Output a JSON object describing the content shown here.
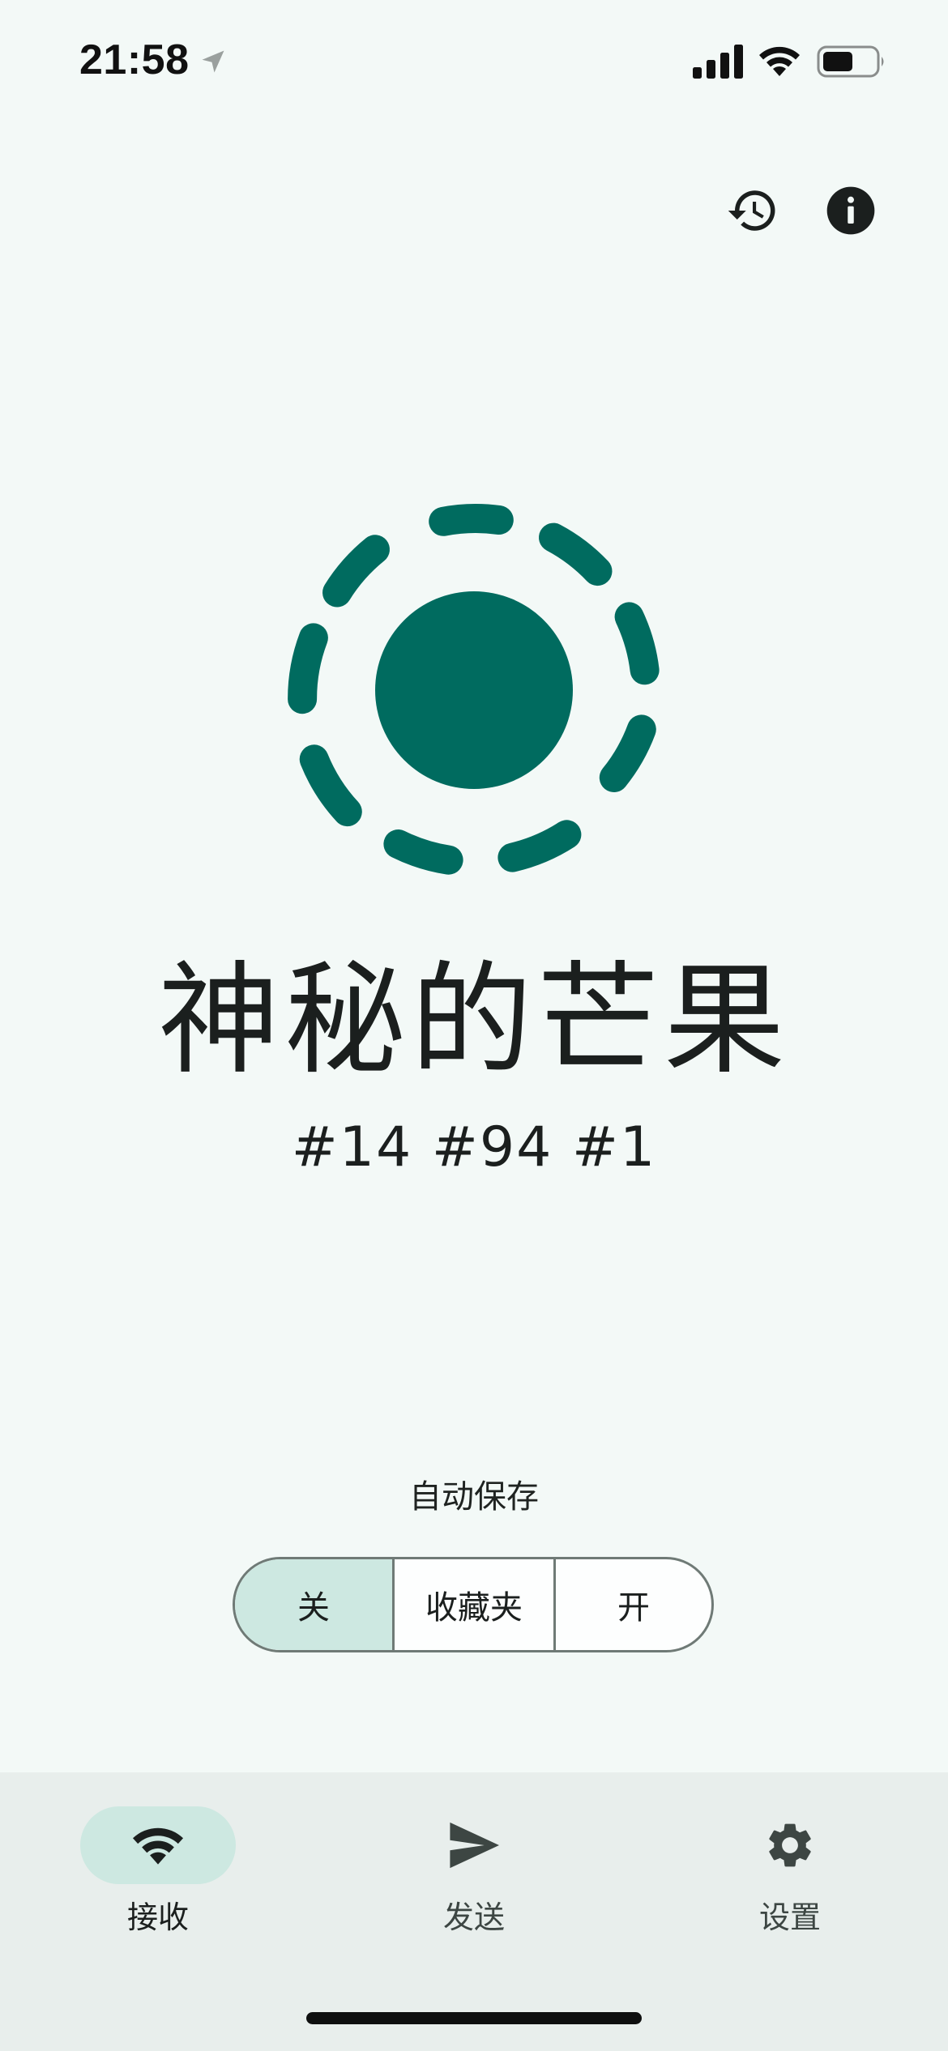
{
  "status_bar": {
    "time": "21:58",
    "location_icon": "location-arrow-icon",
    "signal_icon": "cellular-signal-icon",
    "wifi_icon": "wifi-icon",
    "battery_icon": "battery-icon"
  },
  "top_actions": {
    "history_icon": "history-icon",
    "info_icon": "info-icon"
  },
  "logo_icon": "localsend-logo-icon",
  "device": {
    "name": "神秘的芒果",
    "tags": "#14 #94 #1"
  },
  "auto_save": {
    "label": "自动保存",
    "options": [
      "关",
      "收藏夹",
      "开"
    ],
    "selected": "关"
  },
  "bottom_nav": {
    "items": [
      {
        "label": "接收",
        "icon": "wifi-icon",
        "active": true
      },
      {
        "label": "发送",
        "icon": "send-icon",
        "active": false
      },
      {
        "label": "设置",
        "icon": "gear-icon",
        "active": false
      }
    ]
  },
  "colors": {
    "background": "#f3f9f7",
    "accent": "#006b5f",
    "selected_segment": "#cde8e1",
    "nav_background": "#e8eeec",
    "text": "#1b1f1e"
  }
}
